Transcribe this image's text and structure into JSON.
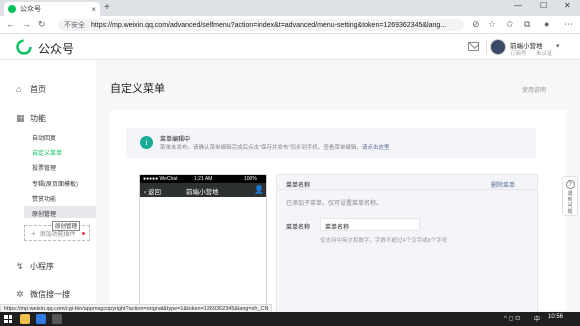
{
  "browser": {
    "tab_title": "公众号",
    "tab_close": "×",
    "new_tab": "+",
    "security": "不安全",
    "url": "https://mp.weixin.qq.com/advanced/selfmenu?action=index&t=advanced/menu-setting&token=1269362345&lang...",
    "win_min": "—",
    "win_max": "☐",
    "win_close": "✕"
  },
  "header": {
    "brand": "公众号",
    "account_name": "前端小营地",
    "account_type": "订阅号",
    "account_status": "未认证",
    "caret": "▾"
  },
  "sidebar": {
    "home": "首页",
    "functions": "功能",
    "items": [
      "自动回复",
      "自定义菜单",
      "投票管理",
      "专辑(原页面模板)",
      "赞赏功能",
      "原创管理"
    ],
    "tooltip": "原创管理",
    "add_function": "添加功能插件",
    "miniprogram": "小程序",
    "search": "微信搜一搜"
  },
  "main": {
    "title": "自定义菜单",
    "usage": "使用说明",
    "notice_title": "菜单编辑中",
    "notice_text": "菜单未发布。请确认菜单编辑完成后点击\"保存并发布\"同步到手机。查看菜单编辑，",
    "notice_link": "请点击这里"
  },
  "phone": {
    "carrier": "●●●●● WeChat",
    "time": "1:21 AM",
    "battery": "100%",
    "back": "‹ 返回",
    "title": "前端小营地"
  },
  "editor": {
    "heading": "菜单名称",
    "delete": "删除菜单",
    "hint": "已添加子菜单，仅可设置菜单名称。",
    "name_label": "菜单名称",
    "name_value": "菜单名称",
    "name_tip": "仅支持中英文和数字，字数不超过4个汉字或8个字母"
  },
  "float": {
    "text": "遇到问题"
  },
  "status_url": "https://mp.weixin.qq.com/cgi-bin/appmsgcopyright?action=orignal&type=1&token=1269362345&lang=zh_CN",
  "taskbar": {
    "ime": "中",
    "time": "10:56",
    "sys": "^ ◻ ⊡"
  }
}
